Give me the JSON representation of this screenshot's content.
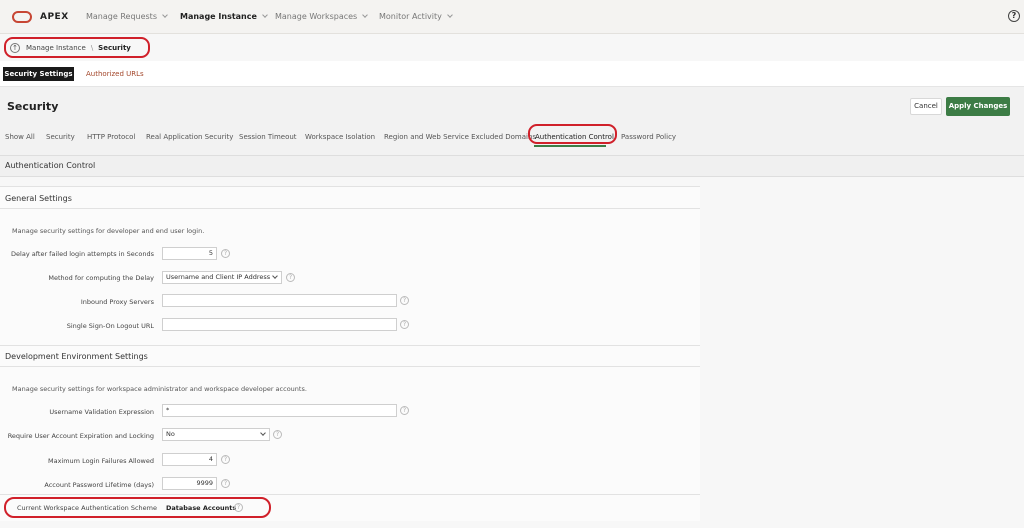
{
  "brand": {
    "name": "APEX",
    "color": "#c74634"
  },
  "nav": {
    "items": [
      {
        "label": "Manage Requests",
        "active": false
      },
      {
        "label": "Manage Instance",
        "active": true
      },
      {
        "label": "Manage Workspaces",
        "active": false
      },
      {
        "label": "Monitor Activity",
        "active": false
      }
    ],
    "help": "?"
  },
  "breadcrumb": {
    "parent": "Manage Instance",
    "separator": "\\",
    "current": "Security"
  },
  "subtabs": {
    "active": "Security Settings",
    "other": "Authorized URLs"
  },
  "header": {
    "title": "Security",
    "cancel": "Cancel",
    "apply": "Apply Changes",
    "apply_color": "#3c7c45"
  },
  "region_tabs": [
    "Show All",
    "Security",
    "HTTP Protocol",
    "Real Application Security",
    "Session Timeout",
    "Workspace Isolation",
    "Region and Web Service Excluded Domains",
    "Authentication Control",
    "Password Policy"
  ],
  "active_region_tab": "Authentication Control",
  "auth_control": {
    "title": "Authentication Control"
  },
  "general": {
    "title": "General Settings",
    "description": "Manage security settings for developer and end user login.",
    "fields": {
      "delay": {
        "label": "Delay after failed login attempts in Seconds",
        "value": "5"
      },
      "method": {
        "label": "Method for computing the Delay",
        "value": "Username and Client IP Address"
      },
      "proxy": {
        "label": "Inbound Proxy Servers",
        "value": ""
      },
      "sso": {
        "label": "Single Sign-On Logout URL",
        "value": ""
      }
    }
  },
  "dev": {
    "title": "Development Environment Settings",
    "description": "Manage security settings for workspace administrator and workspace developer accounts.",
    "fields": {
      "username_regex": {
        "label": "Username Validation Expression",
        "value": "*"
      },
      "expiration": {
        "label": "Require User Account Expiration and Locking",
        "value": "No"
      },
      "max_failures": {
        "label": "Maximum Login Failures Allowed",
        "value": "4"
      },
      "lifetime": {
        "label": "Account Password Lifetime (days)",
        "value": "9999"
      },
      "auth_scheme": {
        "label": "Current Workspace Authentication Scheme",
        "value": "Database Accounts"
      }
    }
  },
  "help_glyph": "?"
}
